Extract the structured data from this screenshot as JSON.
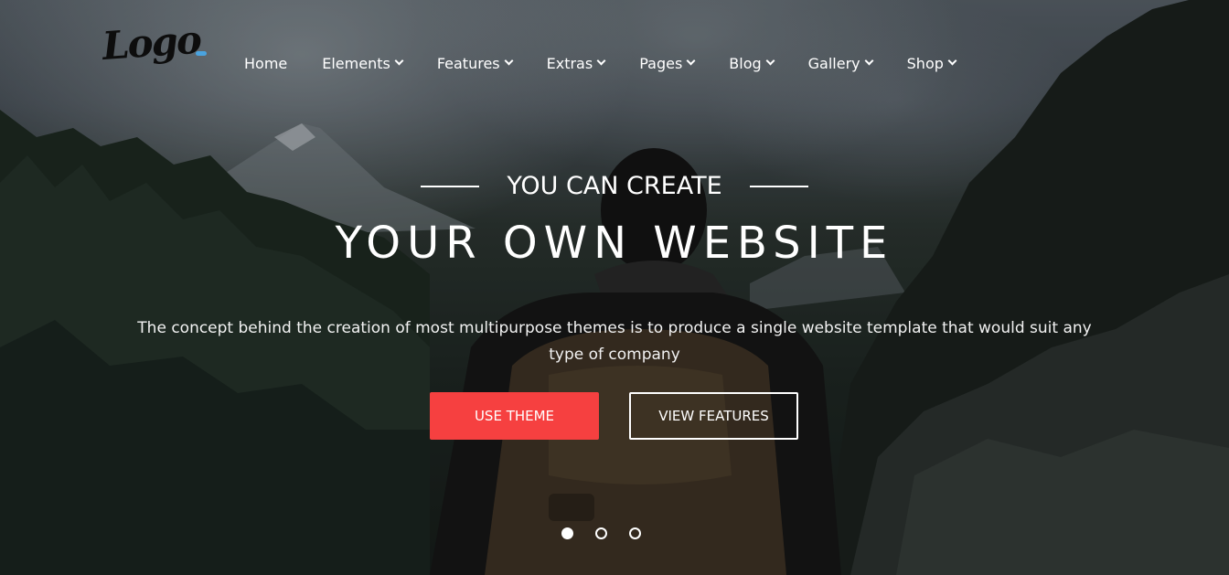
{
  "brand": {
    "logo_text": "Logo",
    "logo_dot_color": "#4aa3df"
  },
  "nav": {
    "items": [
      {
        "label": "Home",
        "has_dropdown": false
      },
      {
        "label": "Elements",
        "has_dropdown": true
      },
      {
        "label": "Features",
        "has_dropdown": true
      },
      {
        "label": "Extras",
        "has_dropdown": true
      },
      {
        "label": "Pages",
        "has_dropdown": true
      },
      {
        "label": "Blog",
        "has_dropdown": true
      },
      {
        "label": "Gallery",
        "has_dropdown": true
      },
      {
        "label": "Shop",
        "has_dropdown": true
      }
    ]
  },
  "hero": {
    "subtitle": "YOU CAN CREATE",
    "headline": "YOUR OWN WEBSITE",
    "description": "The concept behind the creation of most multipurpose themes is to produce a single website template that would suit any type of company",
    "primary_button": "USE THEME",
    "secondary_button": "VIEW FEATURES",
    "accent_color": "#f64040"
  },
  "slider": {
    "slide_count": 3,
    "active_index": 0
  }
}
